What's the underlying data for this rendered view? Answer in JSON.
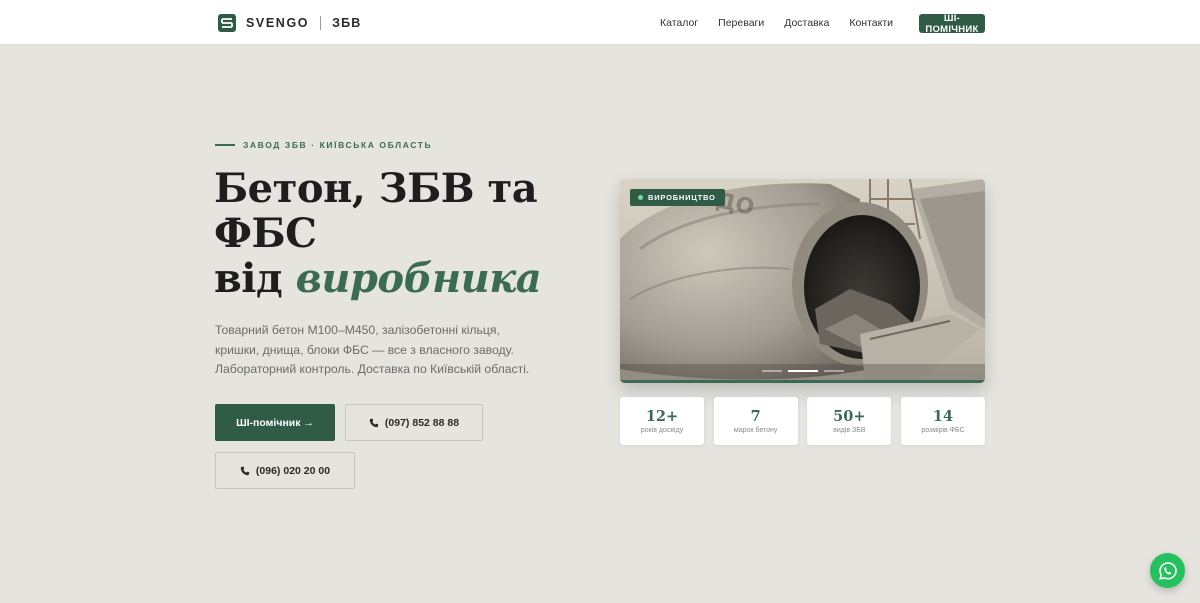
{
  "header": {
    "logo_name": "SVENGO",
    "logo_sub": "ЗБВ",
    "nav": [
      {
        "label": "Каталог"
      },
      {
        "label": "Переваги"
      },
      {
        "label": "Доставка"
      },
      {
        "label": "Контакти"
      }
    ],
    "ai_button": "ШІ-ПОМІЧНИК"
  },
  "hero": {
    "eyebrow": "ЗАВОД ЗБВ · КИЇВСЬКА ОБЛАСТЬ",
    "headline_line1": "Бетон, ЗБВ та",
    "headline_line2": "ФБС",
    "headline_line3_plain": "від ",
    "headline_line3_accent": "виробника",
    "lead": "Товарний бетон М100–М450, залізобетонні кільця, кришки, днища, блоки ФБС — все з власного заводу. Лабораторний контроль. Доставка по Київській області.",
    "cta_primary": "ШІ-помічник →",
    "phone1": "(097) 852 88 88",
    "phone2": "(096) 020 20 00"
  },
  "photo": {
    "badge": "ВИРОБНИЦТВО",
    "slide_count": 3,
    "active_slide": 2
  },
  "stats": [
    {
      "value": "12+",
      "label": "років досвіду"
    },
    {
      "value": "7",
      "label": "марок бетону"
    },
    {
      "value": "50+",
      "label": "видів ЗБВ"
    },
    {
      "value": "14",
      "label": "розмірів ФБС"
    }
  ],
  "colors": {
    "accent": "#2f5b47",
    "accent_text": "#3c6b55",
    "background": "#e6e4df",
    "whatsapp": "#25c15f"
  },
  "icons": {
    "logo": "svengo-logo-icon",
    "phone": "phone-icon",
    "whatsapp": "whatsapp-icon"
  }
}
